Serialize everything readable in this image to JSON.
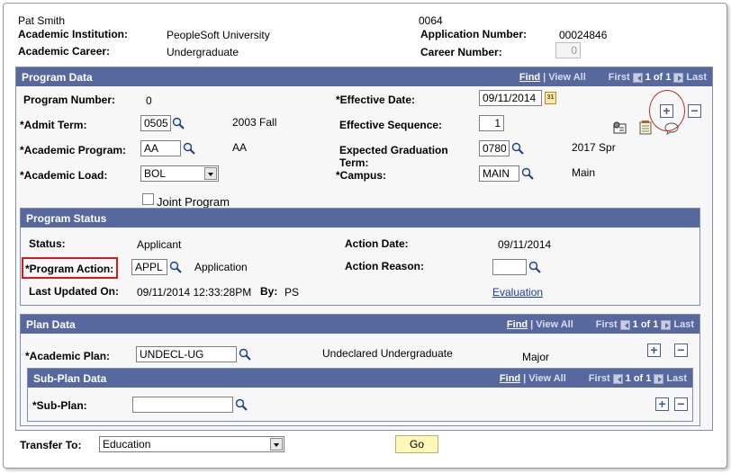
{
  "header": {
    "name": "Pat Smith",
    "id": "0064",
    "institution_label": "Academic Institution:",
    "institution_value": "PeopleSoft University",
    "app_number_label": "Application Number:",
    "app_number_value": "00024846",
    "career_label": "Academic Career:",
    "career_value": "Undergraduate",
    "career_number_label": "Career Number:",
    "career_number_value": "0"
  },
  "program_data": {
    "title": "Program Data",
    "nav": {
      "find": "Find",
      "view_all": "View All",
      "first": "First",
      "count": "1 of 1",
      "last": "Last"
    },
    "program_number_label": "Program Number:",
    "program_number_value": "0",
    "effective_date_label": "*Effective Date:",
    "effective_date_value": "09/11/2014",
    "admit_term_label": "*Admit Term:",
    "admit_term_value": "0505",
    "admit_term_desc": "2003 Fall",
    "eff_seq_label": "Effective Sequence:",
    "eff_seq_value": "1",
    "acad_program_label": "*Academic Program:",
    "acad_program_value": "AA",
    "acad_program_desc": "AA",
    "exp_grad_label_1": "Expected Graduation",
    "exp_grad_label_2": "Term:",
    "exp_grad_value": "0780",
    "exp_grad_desc": "2017 Spr",
    "acad_load_label": "*Academic Load:",
    "acad_load_value": "BOL",
    "campus_label": "*Campus:",
    "campus_value": "MAIN",
    "campus_desc": "Main",
    "joint_program_label": "Joint Program",
    "cal_text": "31"
  },
  "program_status": {
    "title": "Program Status",
    "status_label": "Status:",
    "status_value": "Applicant",
    "action_date_label": "Action Date:",
    "action_date_value": "09/11/2014",
    "program_action_label": "*Program Action:",
    "program_action_value": "APPL",
    "program_action_desc": "Application",
    "action_reason_label": "Action Reason:",
    "action_reason_value": "",
    "last_updated_label": "Last Updated On:",
    "last_updated_value": "09/11/2014 12:33:28PM",
    "by_label": "By:",
    "by_value": "PS",
    "evaluation_link": "Evaluation"
  },
  "plan_data": {
    "title": "Plan Data",
    "nav": {
      "find": "Find",
      "view_all": "View All",
      "first": "First",
      "count": "1 of 1",
      "last": "Last"
    },
    "acad_plan_label": "*Academic Plan:",
    "acad_plan_value": "UNDECL-UG",
    "acad_plan_desc": "Undeclared Undergraduate",
    "plan_type": "Major"
  },
  "subplan_data": {
    "title": "Sub-Plan Data",
    "nav": {
      "find": "Find",
      "view_all": "View All",
      "first": "First",
      "count": "1 of 1",
      "last": "Last"
    },
    "subplan_label": "*Sub-Plan:",
    "subplan_value": ""
  },
  "footer": {
    "transfer_label": "Transfer To:",
    "transfer_value": "Education",
    "go_label": "Go"
  },
  "buttons": {
    "add": "+",
    "delete": "−"
  },
  "colors": {
    "header_bar": "#56689d",
    "highlight": "#d51a1a",
    "go_button": "#fdf7b8"
  }
}
